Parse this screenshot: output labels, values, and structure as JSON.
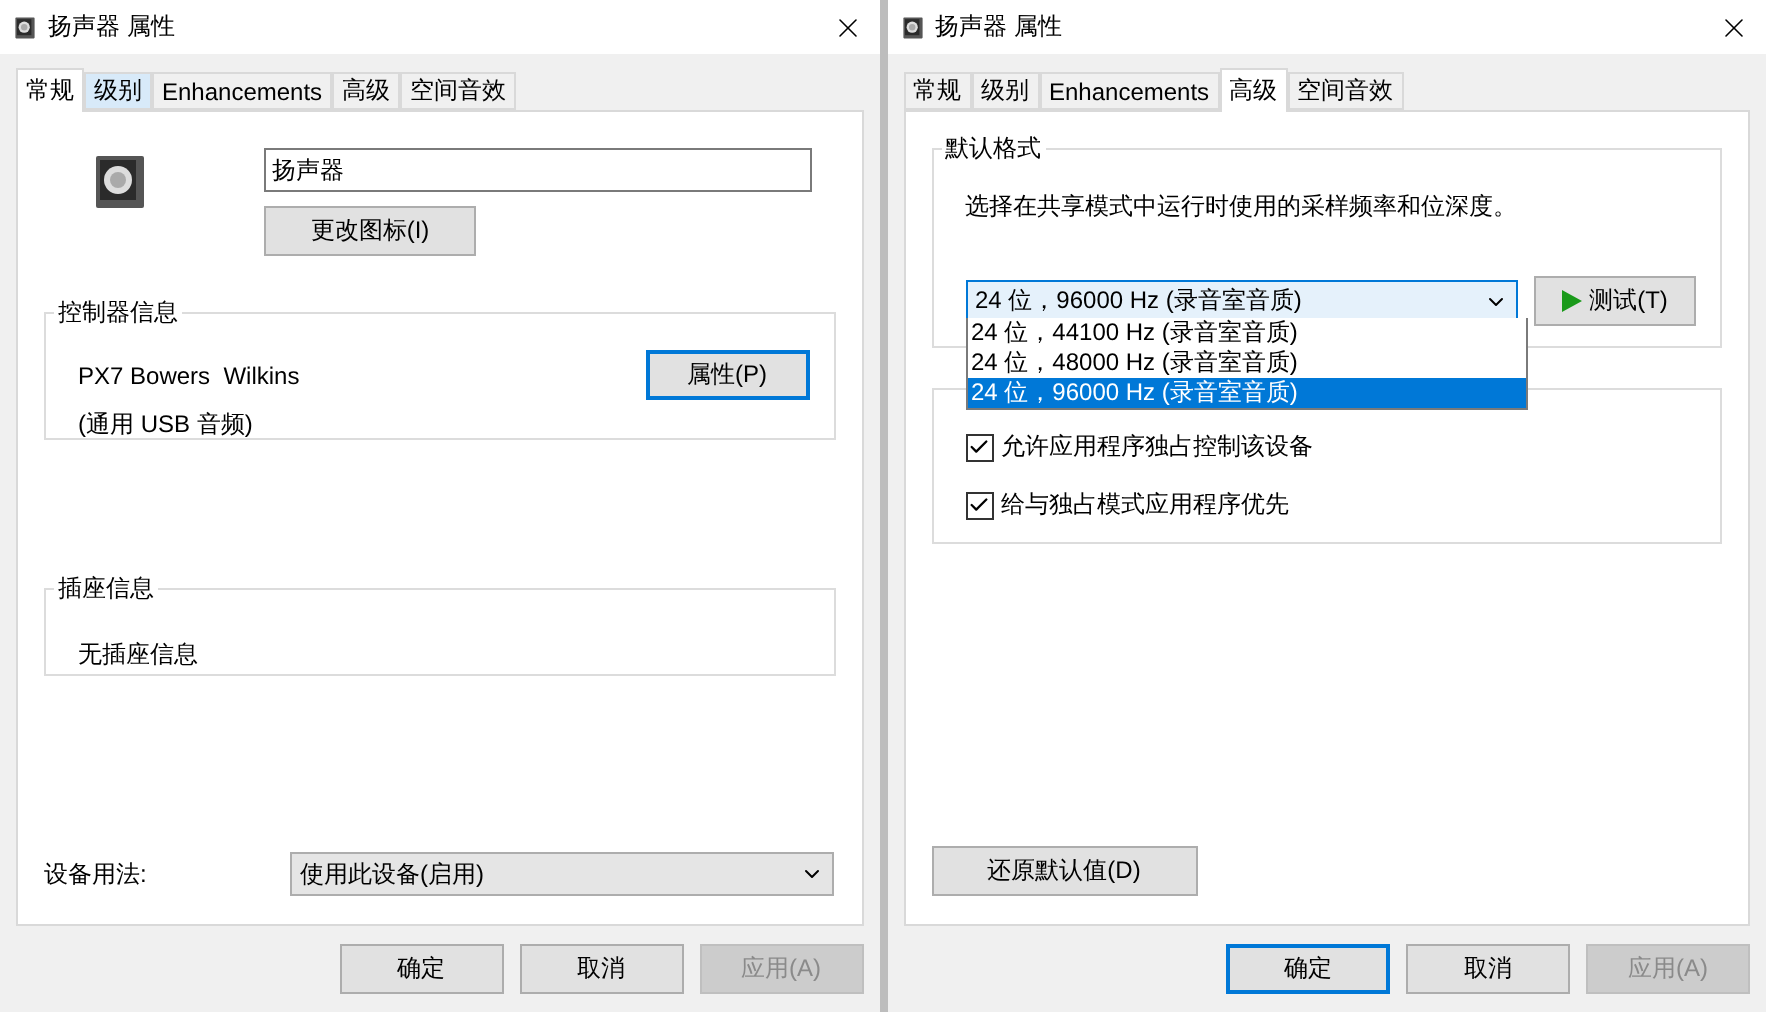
{
  "dialogs": [
    {
      "kind": "general",
      "title": "扬声器 属性",
      "tabs": [
        {
          "label": "常规",
          "selected": true,
          "hovered": false
        },
        {
          "label": "级别",
          "selected": false,
          "hovered": true
        },
        {
          "label": "Enhancements",
          "selected": false,
          "hovered": false
        },
        {
          "label": "高级",
          "selected": false,
          "hovered": false
        },
        {
          "label": "空间音效",
          "selected": false,
          "hovered": false
        }
      ],
      "name_field": {
        "value": "扬声器"
      },
      "change_icon_button": "更改图标(I)",
      "controller_group": {
        "title": "控制器信息",
        "device_name": "PX7 Bowers  Wilkins",
        "device_type": "(通用 USB 音频)",
        "properties_button": {
          "label": "属性(P)",
          "focused": true
        }
      },
      "jack_group": {
        "title": "插座信息",
        "text": "无插座信息"
      },
      "device_usage": {
        "label": "设备用法:",
        "value": "使用此设备(启用)"
      },
      "buttons": [
        {
          "label": "确定",
          "disabled": false,
          "focused": false
        },
        {
          "label": "取消",
          "disabled": false,
          "focused": false
        },
        {
          "label": "应用(A)",
          "disabled": true,
          "focused": false
        }
      ]
    },
    {
      "kind": "advanced",
      "title": "扬声器 属性",
      "tabs": [
        {
          "label": "常规",
          "selected": false,
          "hovered": false
        },
        {
          "label": "级别",
          "selected": false,
          "hovered": false
        },
        {
          "label": "Enhancements",
          "selected": false,
          "hovered": false
        },
        {
          "label": "高级",
          "selected": true,
          "hovered": false
        },
        {
          "label": "空间音效",
          "selected": false,
          "hovered": false
        }
      ],
      "format_group": {
        "title": "默认格式",
        "description": "选择在共享模式中运行时使用的采样频率和位深度。",
        "select": {
          "value": "24 位，96000 Hz (录音室音质)",
          "open": true
        },
        "options": [
          {
            "label": "24 位，44100 Hz (录音室音质)",
            "selected": false
          },
          {
            "label": "24 位，48000 Hz (录音室音质)",
            "selected": false
          },
          {
            "label": "24 位，96000 Hz (录音室音质)",
            "selected": true
          }
        ],
        "test_button": "测试(T)"
      },
      "exclusive_group": {
        "checkboxes": [
          {
            "label": "允许应用程序独占控制该设备",
            "checked": true
          },
          {
            "label": "给与独占模式应用程序优先",
            "checked": true
          }
        ]
      },
      "restore_button": "还原默认值(D)",
      "buttons": [
        {
          "label": "确定",
          "disabled": false,
          "focused": true
        },
        {
          "label": "取消",
          "disabled": false,
          "focused": false
        },
        {
          "label": "应用(A)",
          "disabled": true,
          "focused": false
        }
      ]
    }
  ]
}
